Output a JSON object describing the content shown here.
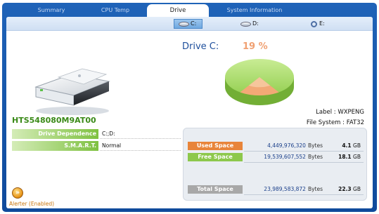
{
  "tabs": [
    {
      "label": "Summary",
      "active": false
    },
    {
      "label": "CPU Temp",
      "active": false
    },
    {
      "label": "Drive",
      "active": true
    },
    {
      "label": "System Information",
      "active": false
    }
  ],
  "drives": [
    {
      "label": "C:",
      "selected": true,
      "icon": "hard-disk-icon"
    },
    {
      "label": "D:",
      "selected": false,
      "icon": "hard-disk-icon"
    },
    {
      "label": "E:",
      "selected": false,
      "icon": "cd-drive-icon"
    }
  ],
  "device": {
    "model": "HTS548080M9AT00",
    "properties": [
      {
        "label": "Drive Dependence",
        "value": "C:;D:"
      },
      {
        "label": "S.M.A.R.T.",
        "value": "Normal"
      }
    ]
  },
  "alerter": {
    "label": "Alerter (Enabled)",
    "icon": "alerter-icon"
  },
  "drive_info": {
    "title": "Drive C:",
    "percent": "19 %",
    "used_fraction": 0.19,
    "label_text": "Label : WXPENG",
    "filesystem_text": "File System : FAT32"
  },
  "space": [
    {
      "label": "Used Space",
      "bytes": "4,449,976,320",
      "unit": "Bytes",
      "gb": "4.1",
      "gb_unit": "GB",
      "color": "#e8843a"
    },
    {
      "label": "Free Space",
      "bytes": "19,539,607,552",
      "unit": "Bytes",
      "gb": "18.1",
      "gb_unit": "GB",
      "color": "#8dc84c"
    },
    {
      "label": "Total Space",
      "bytes": "23,989,583,872",
      "unit": "Bytes",
      "gb": "22.3",
      "gb_unit": "GB",
      "color": "#a8a8a8"
    }
  ],
  "colors": {
    "accent": "#1f63b8",
    "used": "#f0a072",
    "free": "#9ed35c"
  }
}
